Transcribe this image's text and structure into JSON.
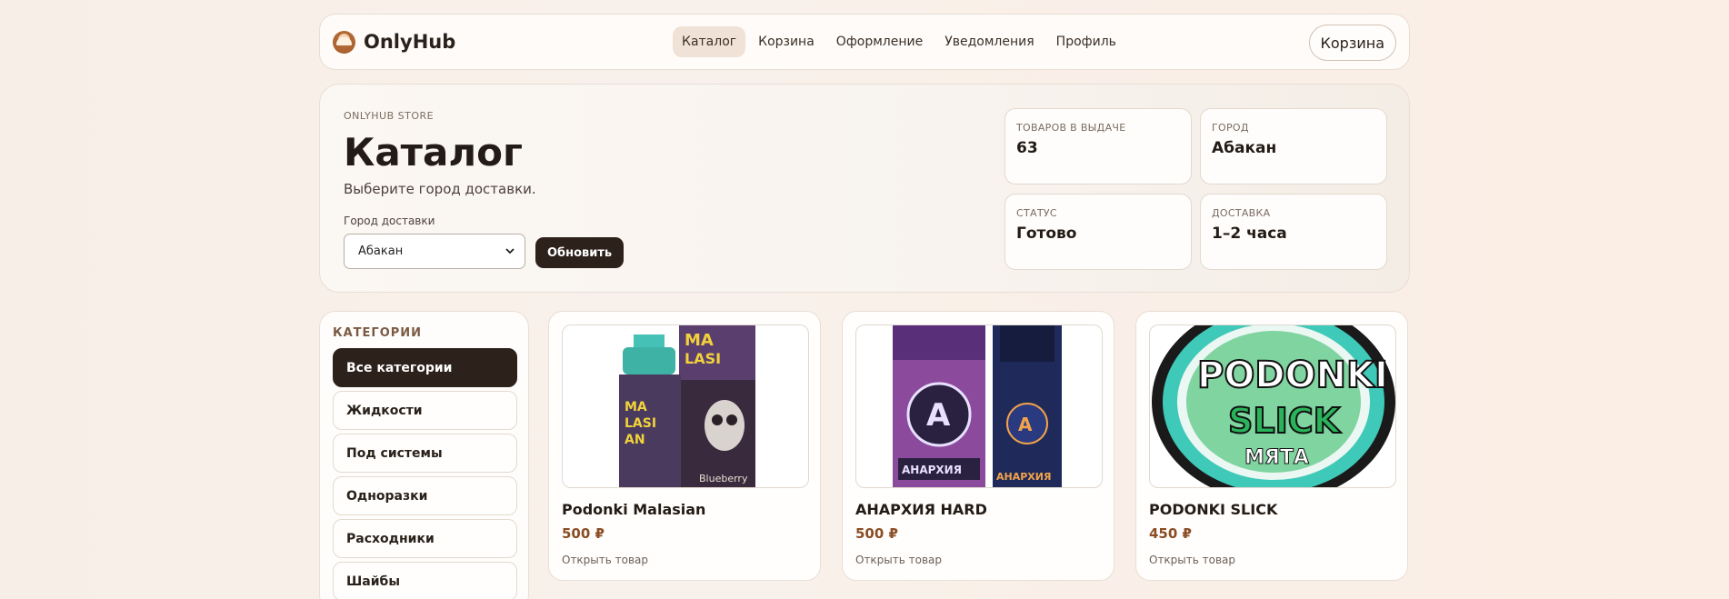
{
  "brand": {
    "name": "OnlyHub"
  },
  "nav": {
    "items": [
      {
        "label": "Каталог",
        "active": true
      },
      {
        "label": "Корзина"
      },
      {
        "label": "Оформление"
      },
      {
        "label": "Уведомления"
      },
      {
        "label": "Профиль"
      }
    ],
    "cart_button": "Корзина"
  },
  "hero": {
    "eyebrow": "ONLYHUB STORE",
    "title": "Каталог",
    "subtitle": "Выберите город доставки.",
    "city_label": "Город доставки",
    "city_selected": "Абакан",
    "refresh_button": "Обновить",
    "stats": [
      {
        "label": "ТОВАРОВ В ВЫДАЧЕ",
        "value": "63"
      },
      {
        "label": "ГОРОД",
        "value": "Абакан"
      },
      {
        "label": "СТАТУС",
        "value": "Готово"
      },
      {
        "label": "ДОСТАВКА",
        "value": "1–2 часа"
      }
    ]
  },
  "sidebar": {
    "title": "КАТЕГОРИИ",
    "items": [
      {
        "label": "Все категории",
        "active": true
      },
      {
        "label": "Жидкости"
      },
      {
        "label": "Под системы"
      },
      {
        "label": "Одноразки"
      },
      {
        "label": "Расходники"
      },
      {
        "label": "Шайбы"
      }
    ]
  },
  "products": [
    {
      "name": "Podonki Malasian",
      "price": "500 ₽",
      "link": "Открыть товар",
      "image": "malasian-bottle-and-box"
    },
    {
      "name": "АНАРХИЯ HARD",
      "price": "500 ₽",
      "link": "Открыть товар",
      "image": "anarchy-hard-bottle-and-box"
    },
    {
      "name": "PODONKI SLICK",
      "price": "450 ₽",
      "link": "Открыть товар",
      "image": "podonki-slick-tin"
    }
  ],
  "colors": {
    "accent_dark": "#2d221b",
    "price": "#8a4d24",
    "nav_active_bg": "#f0e2d6"
  }
}
